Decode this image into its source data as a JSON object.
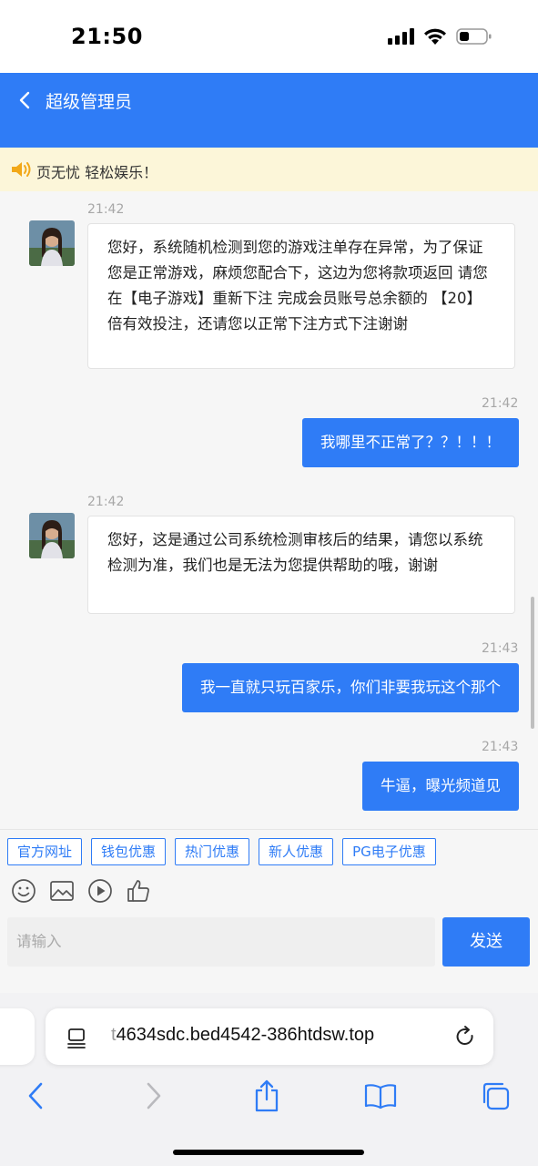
{
  "status_bar": {
    "time": "21:50"
  },
  "header": {
    "title": "超级管理员"
  },
  "notice": {
    "text": "页无忧 轻松娱乐！"
  },
  "messages": [
    {
      "time": "21:42",
      "direction": "incoming",
      "text": "您好，系统随机检测到您的游戏注单存在异常，为了保证您是正常游戏，麻烦您配合下，这边为您将款项返回 请您在【电子游戏】重新下注 完成会员账号总余额的 【20】倍有效投注，还请您以正常下注方式下注谢谢"
    },
    {
      "time": "21:42",
      "direction": "outgoing",
      "text": "我哪里不正常了？？！！！"
    },
    {
      "time": "21:42",
      "direction": "incoming",
      "text": "您好，这是通过公司系统检测审核后的结果，请您以系统检测为准，我们也是无法为您提供帮助的哦，谢谢"
    },
    {
      "time": "21:43",
      "direction": "outgoing",
      "text": "我一直就只玩百家乐，你们非要我玩这个那个"
    },
    {
      "time": "21:43",
      "direction": "outgoing",
      "text": "牛逼，曝光频道见"
    }
  ],
  "quick_replies": [
    "官方网址",
    "钱包优惠",
    "热门优惠",
    "新人优惠",
    "PG电子优惠"
  ],
  "tools": [
    "emoji-icon",
    "image-icon",
    "video-icon",
    "thumbs-up-icon"
  ],
  "composer": {
    "placeholder": "请输入",
    "send_label": "发送"
  },
  "browser": {
    "url_faded": "t",
    "url_main": "4634sdc.bed4542-386htdsw.top"
  },
  "colors": {
    "accent": "#2f7cf6",
    "notice_bg": "#fcf6d9"
  }
}
